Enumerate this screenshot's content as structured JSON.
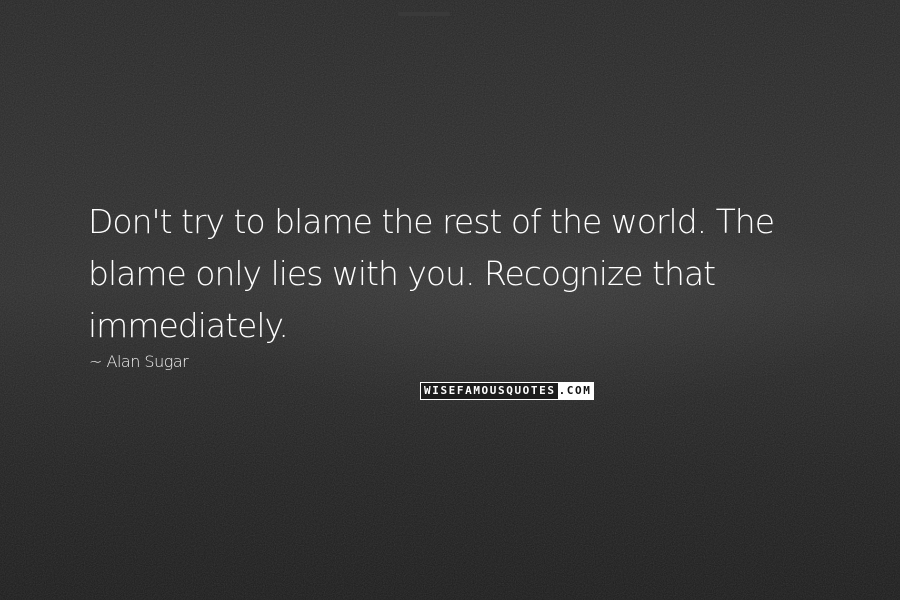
{
  "quote": {
    "lines": [
      "Don't try to blame the rest of the world. The",
      "blame only lies with you. Recognize that",
      "immediately."
    ],
    "author": "~ Alan Sugar"
  },
  "watermark": {
    "main": "WISEFAMOUSQUOTES",
    "separator": ".",
    "tld": "COM"
  },
  "colors": {
    "text": "#ffffff",
    "background": "#262626"
  }
}
